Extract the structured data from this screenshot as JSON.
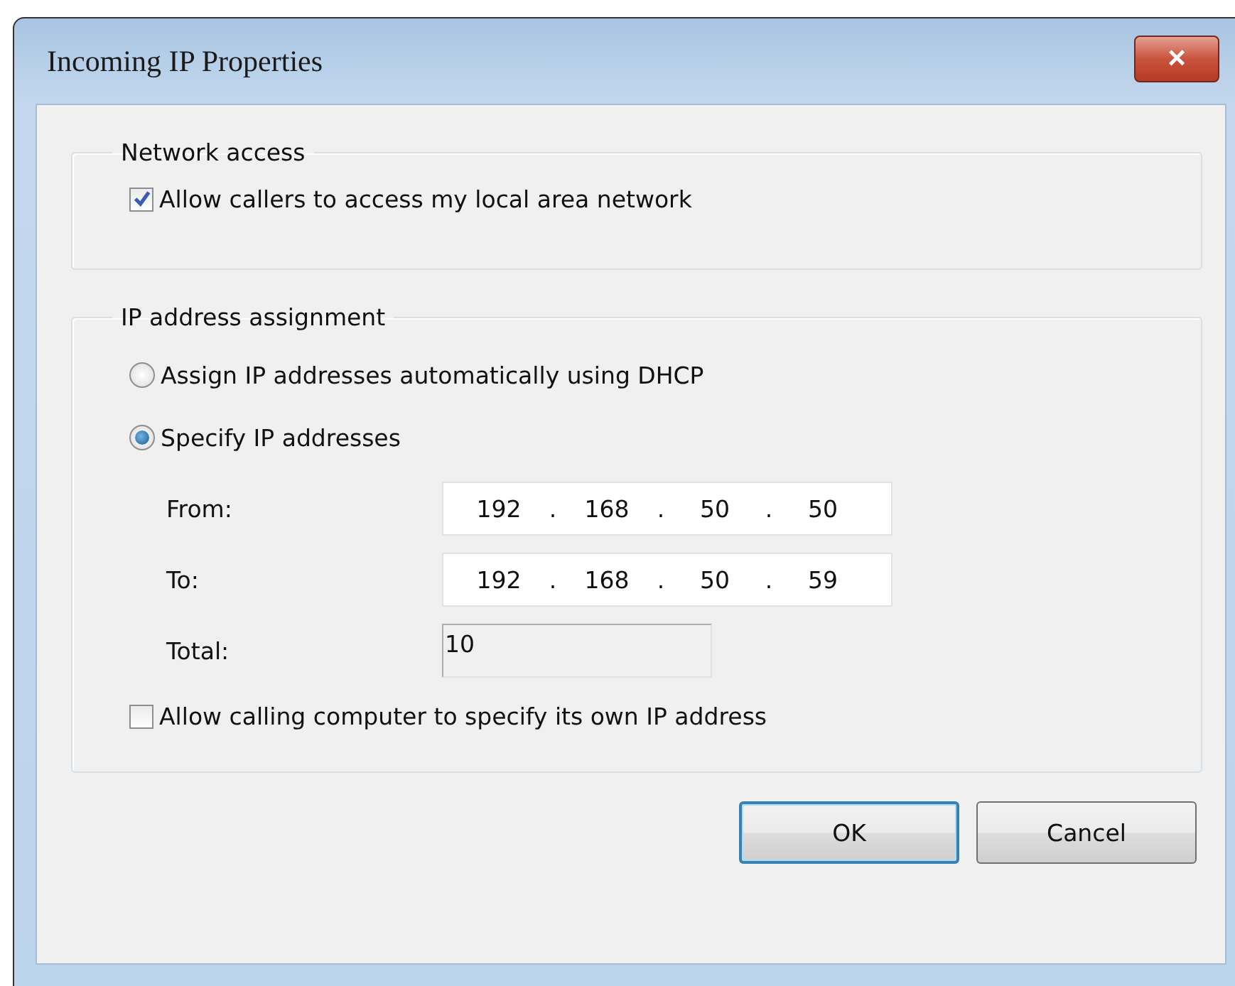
{
  "window": {
    "title": "Incoming IP Properties",
    "close": "×"
  },
  "network_access": {
    "title": "Network access",
    "checkbox": {
      "label": "Allow callers to access my local area network",
      "checked": true
    }
  },
  "ip_assignment": {
    "title": "IP address assignment",
    "options": [
      {
        "label": "Assign IP addresses automatically using DHCP",
        "selected": false
      },
      {
        "label": "Specify IP addresses",
        "selected": true
      }
    ],
    "ranges": [
      {
        "label": "From:",
        "octets": [
          "192",
          "168",
          "50",
          "50"
        ],
        "separator": "."
      },
      {
        "label": "To:",
        "octets": [
          "192",
          "168",
          "50",
          "59"
        ],
        "separator": "."
      }
    ],
    "total": {
      "label": "Total:",
      "value": "10",
      "disabled": true
    },
    "checkbox": {
      "label": "Allow calling computer to specify its own IP address",
      "checked": false
    }
  },
  "buttons": [
    {
      "label": "OK",
      "default": true
    },
    {
      "label": "Cancel",
      "default": false
    }
  ]
}
